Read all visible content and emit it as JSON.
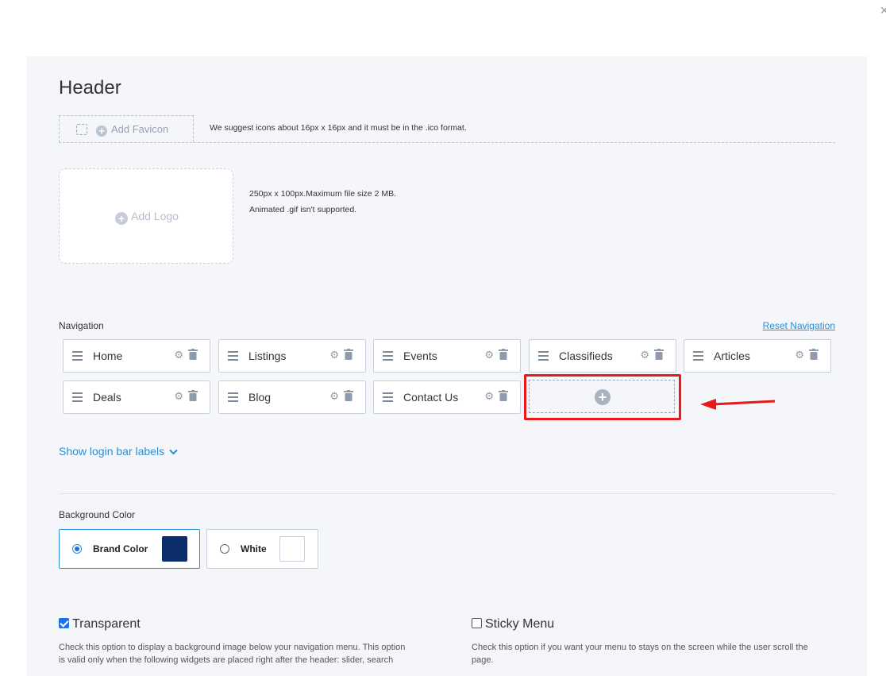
{
  "window": {
    "close_glyph": "×"
  },
  "header": {
    "title": "Header"
  },
  "favicon": {
    "add_label": "Add Favicon",
    "hint": "We suggest icons about 16px x 16px and it must be in the .ico format."
  },
  "logo": {
    "add_label": "Add Logo",
    "hint_line1": "250px x 100px.Maximum file size 2 MB.",
    "hint_line2": "Animated .gif isn't supported."
  },
  "navigation": {
    "label": "Navigation",
    "reset_label": "Reset Navigation",
    "items": [
      {
        "label": "Home"
      },
      {
        "label": "Listings"
      },
      {
        "label": "Events"
      },
      {
        "label": "Classifieds"
      },
      {
        "label": "Articles"
      },
      {
        "label": "Deals"
      },
      {
        "label": "Blog"
      },
      {
        "label": "Contact Us"
      }
    ],
    "add_icon": "plus-circle-icon"
  },
  "login_bar": {
    "label": "Show login bar labels",
    "icon": "chevron-down-icon"
  },
  "background": {
    "label": "Background Color",
    "options": [
      {
        "label": "Brand Color",
        "selected": true,
        "color": "#0b2e6b"
      },
      {
        "label": "White",
        "selected": false,
        "color": "#ffffff"
      }
    ]
  },
  "options": {
    "transparent": {
      "label": "Transparent",
      "checked": true,
      "description_line1": "Check this option to display a background image below your navigation menu. This option",
      "description_line2": "is valid only when the following widgets are placed right after the header: slider, search"
    },
    "sticky": {
      "label": "Sticky Menu",
      "checked": false,
      "description_line1": "Check this option if you want your menu to stays on the screen while the user scroll the",
      "description_line2": "page."
    }
  },
  "colors": {
    "accent": "#2a8fd4",
    "highlight": "#e81919",
    "brand": "#0b2e6b"
  }
}
